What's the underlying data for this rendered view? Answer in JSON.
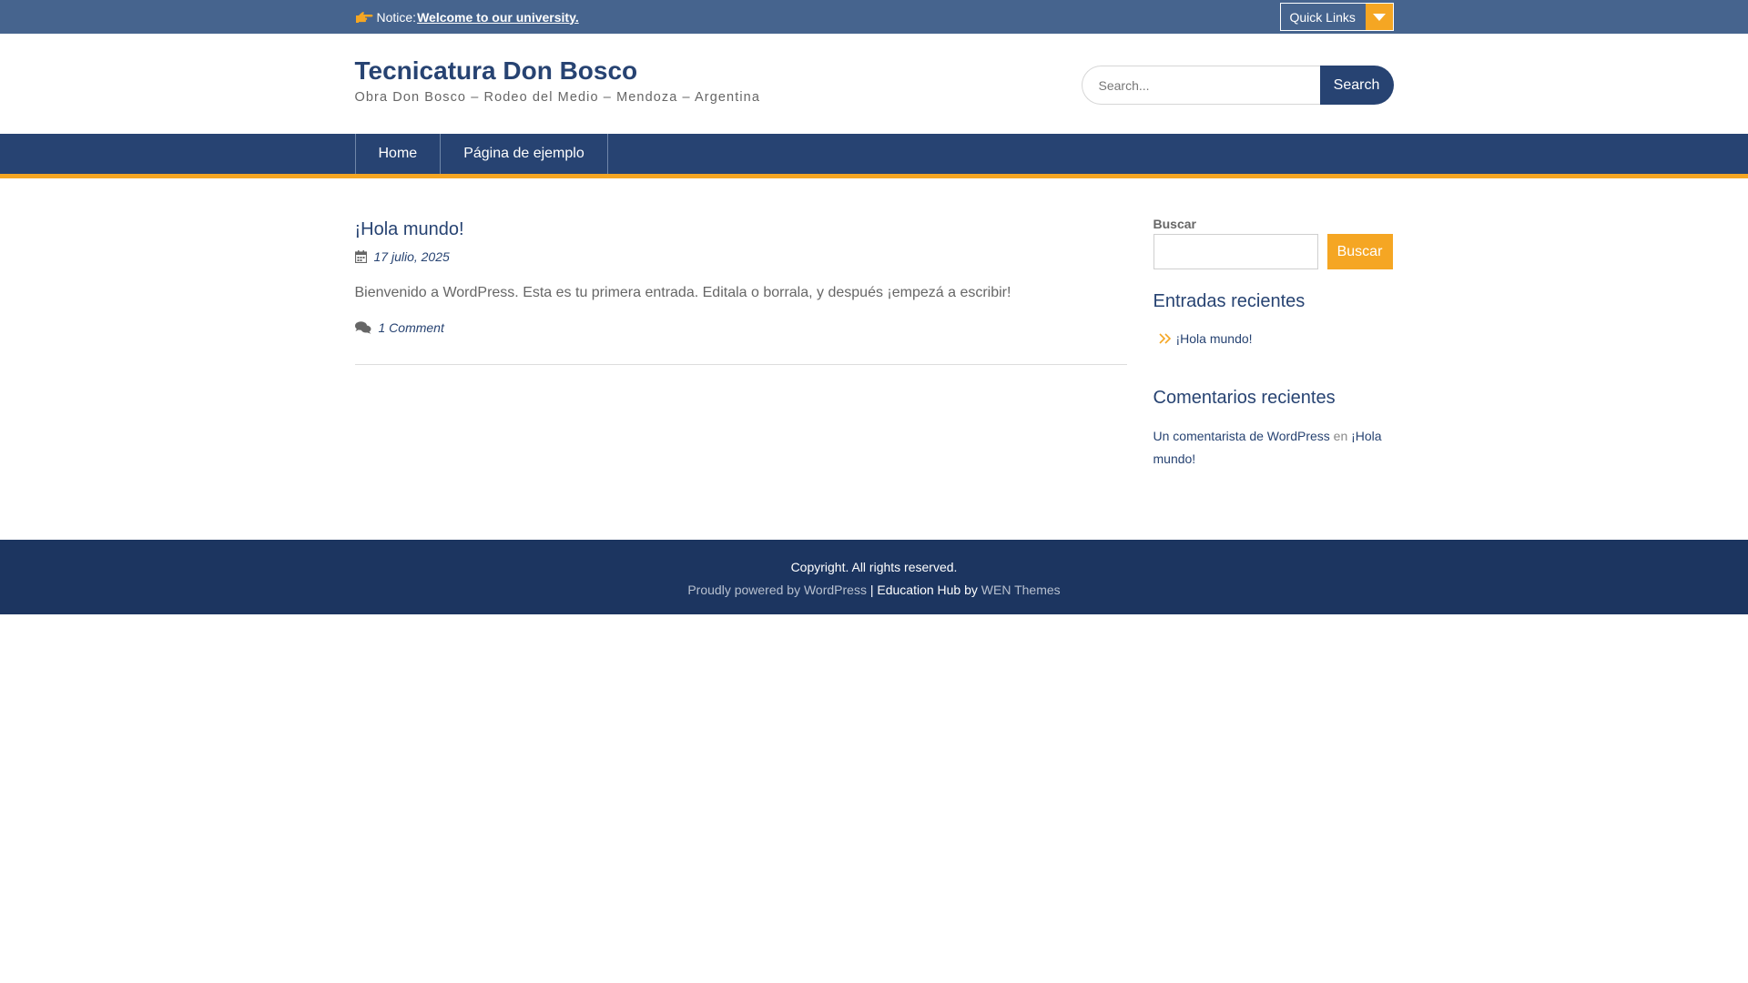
{
  "colors": {
    "topbar": "#46648e",
    "primary": "#274372",
    "accent": "#f5a623",
    "footer": "#1c3560"
  },
  "topbar": {
    "notice_icon": "hand-point-right-icon",
    "notice_label": "Notice:",
    "notice_link": "Welcome to our university.",
    "quick_links_label": "Quick Links",
    "quick_links_icon": "caret-down-icon"
  },
  "header": {
    "site_title": "Tecnicatura Don Bosco",
    "site_description": "Obra Don Bosco – Rodeo del Medio – Mendoza – Argentina",
    "search_placeholder": "Search...",
    "search_button": "Search"
  },
  "nav": {
    "items": [
      {
        "label": "Home"
      },
      {
        "label": "Página de ejemplo"
      }
    ]
  },
  "post": {
    "title": "¡Hola mundo!",
    "date_icon": "calendar-icon",
    "date": "17 julio, 2025",
    "excerpt": "Bienvenido a WordPress. Esta es tu primera entrada. Editala o borrala, y después ¡empezá a escribir!",
    "comments_icon": "comments-icon",
    "comments": "1 Comment"
  },
  "sidebar": {
    "search_label": "Buscar",
    "search_button": "Buscar",
    "recent_posts_title": "Entradas recientes",
    "recent_posts": [
      {
        "icon": "double-chevron-right-icon",
        "label": "¡Hola mundo!"
      }
    ],
    "recent_comments_title": "Comentarios recientes",
    "recent_comment": {
      "author": "Un comentarista de WordPress",
      "connector": "en",
      "post": "¡Hola mundo!"
    }
  },
  "footer": {
    "copyright": "Copyright. All rights reserved.",
    "powered_prefix": "Proudly powered by WordPress",
    "separator": "| Education Hub by",
    "theme_author": "WEN Themes"
  }
}
